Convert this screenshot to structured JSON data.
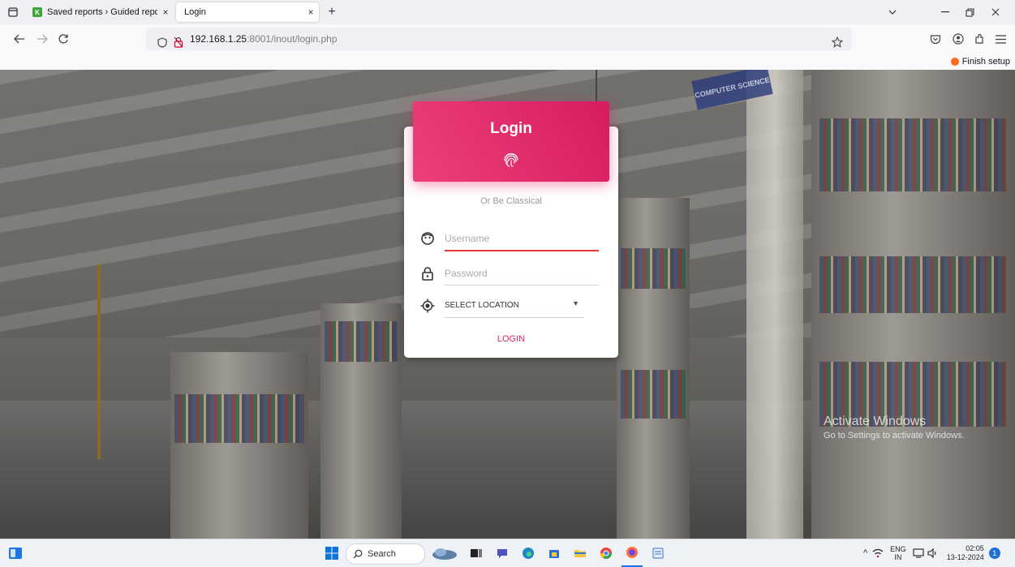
{
  "browser": {
    "tabs": [
      {
        "title": "Saved reports › Guided reports › ",
        "close": "×",
        "favicon_letter": "K",
        "favicon_color": "#3ea43b"
      },
      {
        "title": "Login",
        "close": "×"
      }
    ],
    "new_tab": "+",
    "url_host": "192.168.1.25",
    "url_rest": ":8001/inout/login.php",
    "finish_setup": "Finish setup"
  },
  "login": {
    "title": "Login",
    "subtitle": "Or Be Classical",
    "username_placeholder": "Username",
    "password_placeholder": "Password",
    "location_value": "SELECT LOCATION",
    "button_label": "LOGIN",
    "accent": "#e91e63"
  },
  "watermark": {
    "line1": "Activate Windows",
    "line2": "Go to Settings to activate Windows."
  },
  "taskbar": {
    "search_label": "Search",
    "lang_top": "ENG",
    "lang_bottom": "IN",
    "time": "02:05",
    "date": "13-12-2024",
    "notification_count": "1"
  },
  "decor": {
    "sign_text": "COMPUTER SCIENCE"
  }
}
